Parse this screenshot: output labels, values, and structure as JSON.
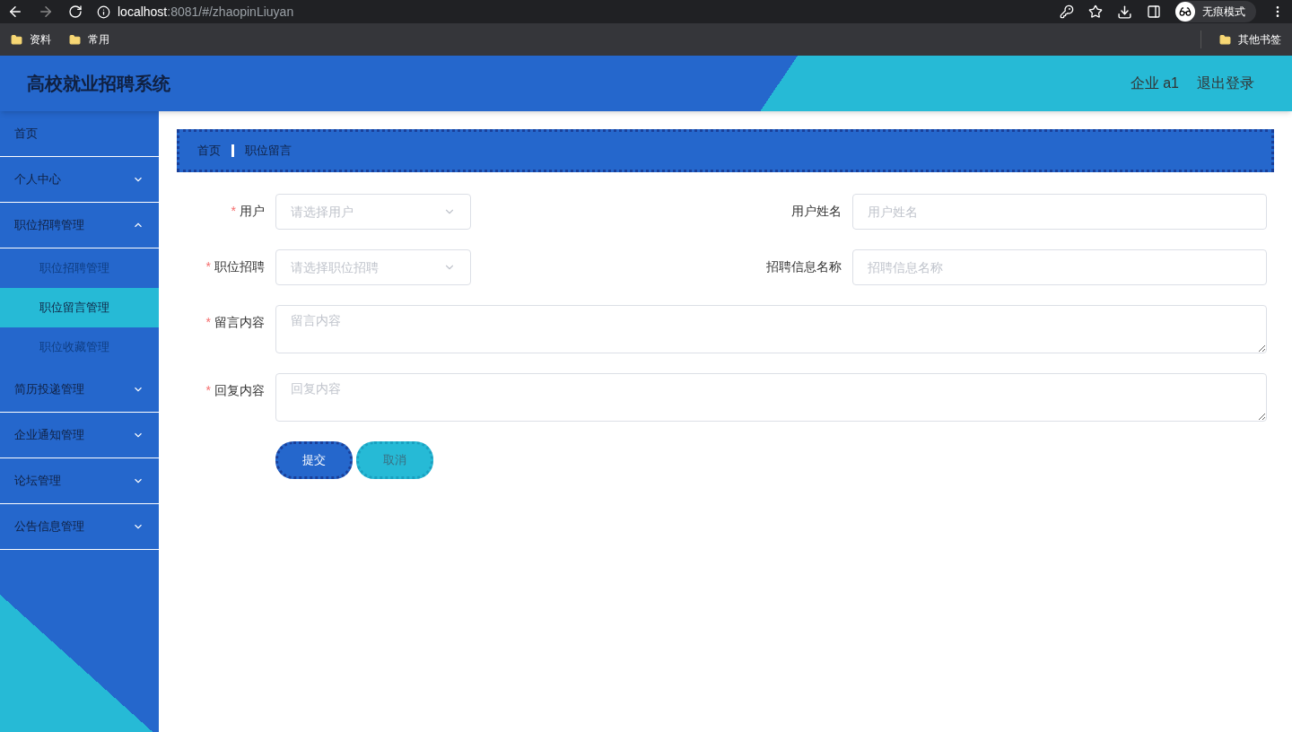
{
  "browser": {
    "url_host": "localhost",
    "url_rest": ":8081/#/zhaopinLiuyan",
    "profile": "无痕模式",
    "bookmarks": [
      "资料",
      "常用"
    ],
    "other_bookmarks": "其他书签"
  },
  "header": {
    "title": "高校就业招聘系统",
    "user": "企业 a1",
    "logout": "退出登录"
  },
  "sidebar": {
    "items": [
      {
        "label": "首页"
      },
      {
        "label": "个人中心",
        "expanded": false
      },
      {
        "label": "职位招聘管理",
        "expanded": true,
        "children": [
          {
            "label": "职位招聘管理",
            "selected": false
          },
          {
            "label": "职位留言管理",
            "selected": true
          },
          {
            "label": "职位收藏管理",
            "selected": false
          }
        ]
      },
      {
        "label": "简历投递管理",
        "expanded": false
      },
      {
        "label": "企业通知管理",
        "expanded": false
      },
      {
        "label": "论坛管理",
        "expanded": false
      },
      {
        "label": "公告信息管理",
        "expanded": false
      }
    ]
  },
  "breadcrumb": [
    "首页",
    "职位留言"
  ],
  "form": {
    "required_mark": "*",
    "rows": [
      [
        {
          "kind": "select",
          "label": "用户",
          "required": true,
          "placeholder": "请选择用户"
        },
        {
          "kind": "input",
          "label": "用户姓名",
          "required": false,
          "placeholder": "用户姓名"
        }
      ],
      [
        {
          "kind": "select",
          "label": "职位招聘",
          "required": true,
          "placeholder": "请选择职位招聘"
        },
        {
          "kind": "input",
          "label": "招聘信息名称",
          "required": false,
          "placeholder": "招聘信息名称"
        }
      ],
      [
        {
          "kind": "textarea",
          "label": "留言内容",
          "required": true,
          "placeholder": "留言内容"
        }
      ],
      [
        {
          "kind": "textarea",
          "label": "回复内容",
          "required": true,
          "placeholder": "回复内容"
        }
      ]
    ],
    "buttons": [
      {
        "kind": "primary",
        "label": "提交"
      },
      {
        "kind": "secondary",
        "label": "取消"
      }
    ]
  }
}
